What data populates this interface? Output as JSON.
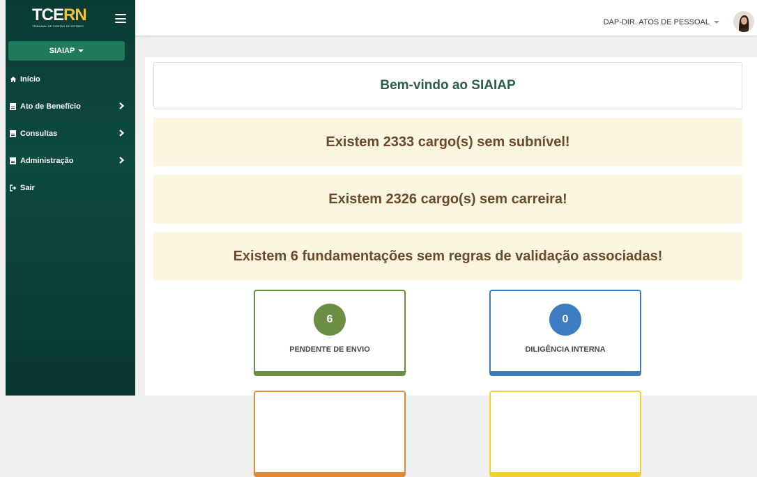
{
  "sidebar": {
    "logo_main": "TCE",
    "logo_accent": "RN",
    "logo_sub": "TRIBUNAL DE CONTAS DO ESTADO",
    "app_label": "SIAIAP",
    "items": [
      {
        "label": "Início",
        "icon": "home-icon"
      },
      {
        "label": "Ato de Benefício",
        "icon": "file-icon"
      },
      {
        "label": "Consultas",
        "icon": "file-icon"
      },
      {
        "label": "Administração",
        "icon": "file-icon"
      },
      {
        "label": "Sair",
        "icon": "sign-out-icon"
      }
    ]
  },
  "header": {
    "user_label": "DAP-DIR. ATOS DE PESSOAL"
  },
  "main": {
    "welcome": "Bem-vindo ao SIAIAP",
    "alerts": [
      "Existem 2333 cargo(s) sem subnível!",
      "Existem 2326 cargo(s) sem carreira!",
      "Existem 6 fundamentações sem regras de validação associadas!"
    ],
    "cards": [
      {
        "count": "6",
        "label": "PENDENTE DE ENVIO",
        "color": "#6a8f42"
      },
      {
        "count": "0",
        "label": "DILIGÊNCIA INTERNA",
        "color": "#3d7cc0"
      },
      {
        "color": "#e08b3a"
      },
      {
        "color": "#f0d033"
      }
    ]
  },
  "colors": {
    "sidebar_bg": "#0b4038",
    "accent": "#1f7a5c",
    "alert_bg": "#fcf5df",
    "alert_text": "#6b4a2a",
    "welcome_text": "#2b5e4c"
  }
}
